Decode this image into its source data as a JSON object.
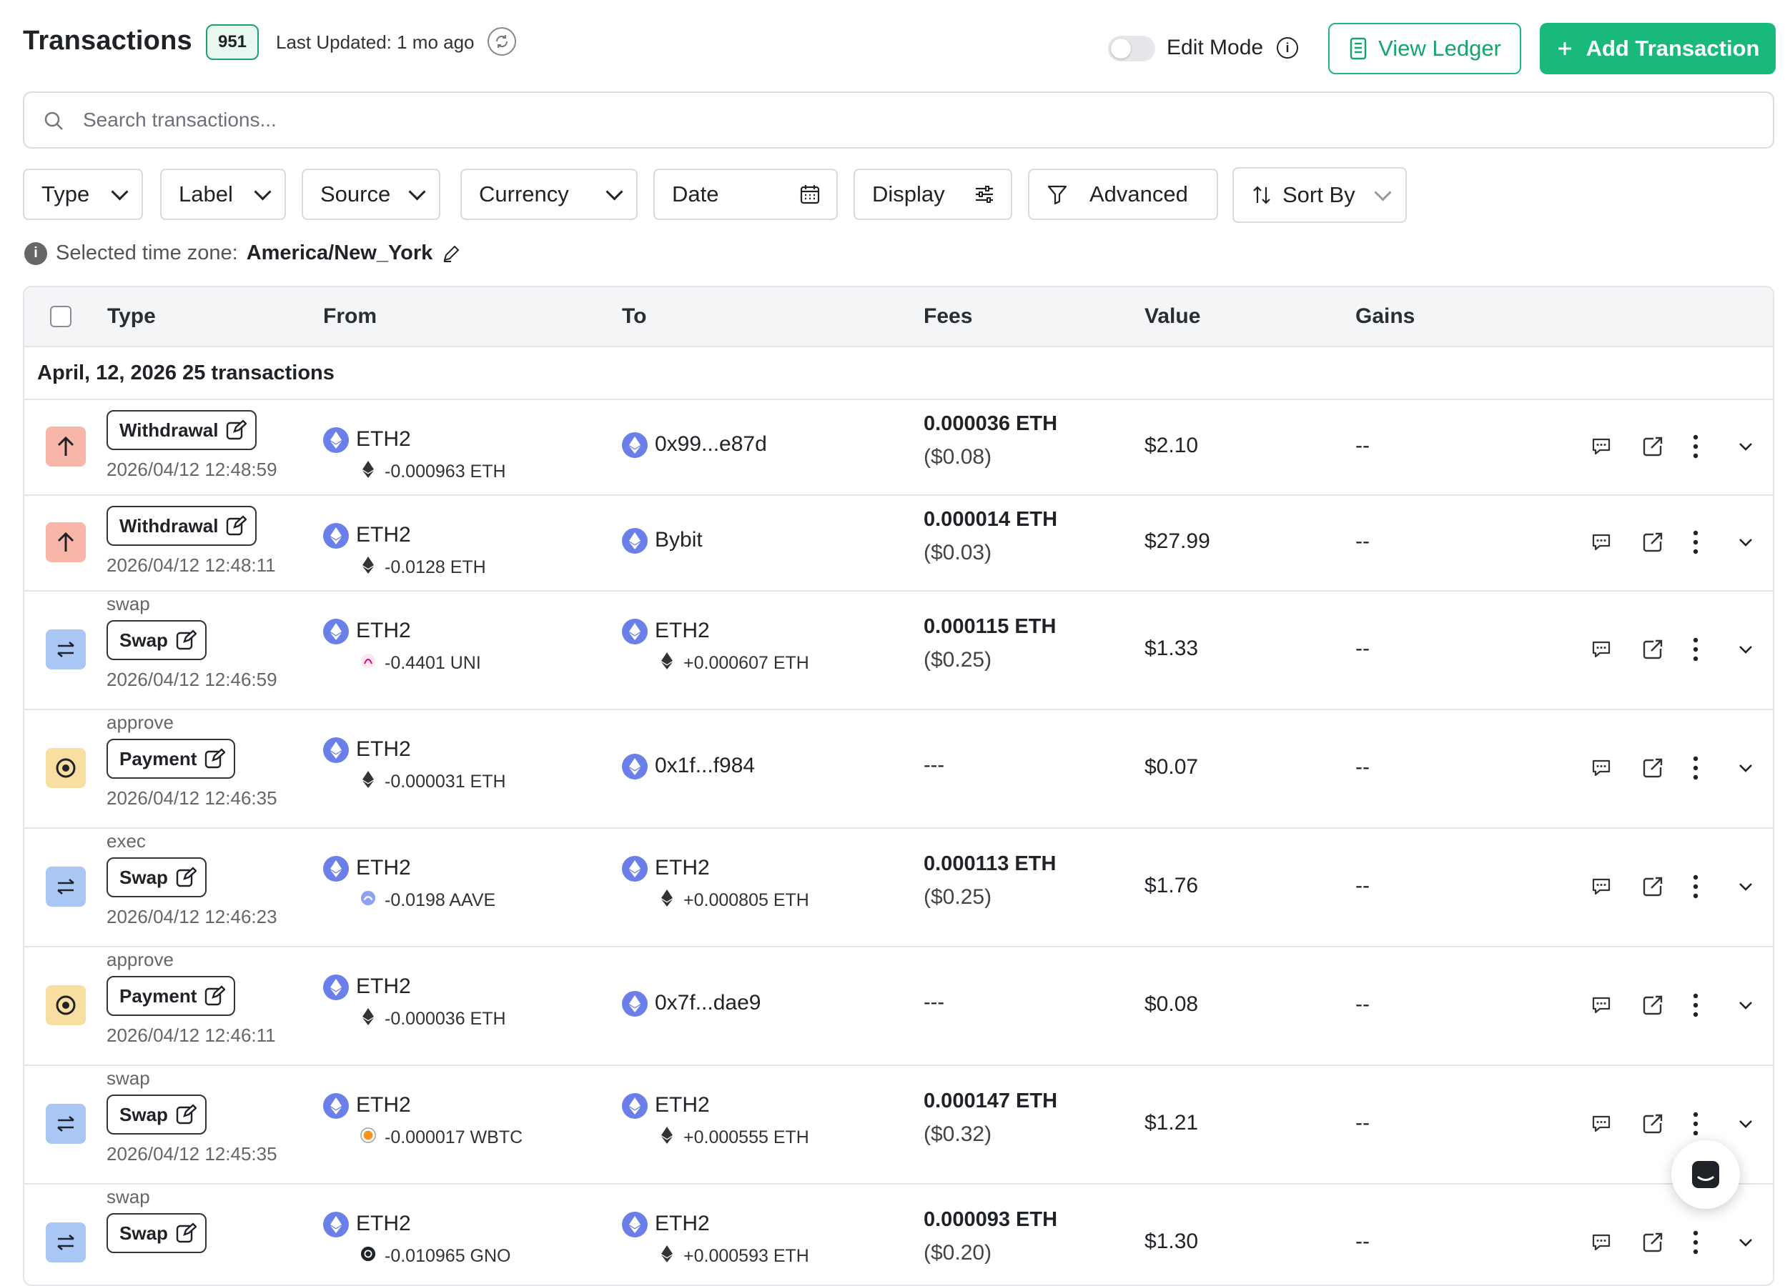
{
  "header": {
    "title": "Transactions",
    "count": "951",
    "last_updated": "Last Updated: 1 mo ago",
    "edit_mode_label": "Edit Mode",
    "edit_mode_on": false,
    "view_ledger": "View Ledger",
    "add_transaction": "Add Transaction"
  },
  "search": {
    "placeholder": "Search transactions..."
  },
  "filters": [
    "Type",
    "Label",
    "Source",
    "Currency",
    "Date",
    "Display",
    "Advanced",
    "Sort By"
  ],
  "timezone": {
    "prefix": "Selected time zone:",
    "value": "America/New_York"
  },
  "table": {
    "columns": [
      "Type",
      "From",
      "To",
      "Fees",
      "Value",
      "Gains"
    ],
    "group": "April, 12, 2026 25 transactions",
    "rows": [
      {
        "kind": "withdrawal",
        "subtitle": "",
        "label": "Withdrawal",
        "time": "2026/04/12 12:48:59",
        "from": "ETH2",
        "from_amount": "-0.000963 ETH",
        "from_asset": "ETH",
        "to": "0x99...e87d",
        "to_amount": "",
        "fee": "0.000036 ETH",
        "fee_usd": "($0.08)",
        "value": "$2.10",
        "gains": "--"
      },
      {
        "kind": "withdrawal",
        "subtitle": "",
        "label": "Withdrawal",
        "time": "2026/04/12 12:48:11",
        "from": "ETH2",
        "from_amount": "-0.0128 ETH",
        "from_asset": "ETH",
        "to": "Bybit",
        "to_amount": "",
        "fee": "0.000014 ETH",
        "fee_usd": "($0.03)",
        "value": "$27.99",
        "gains": "--"
      },
      {
        "kind": "swap",
        "subtitle": "swap",
        "label": "Swap",
        "time": "2026/04/12 12:46:59",
        "from": "ETH2",
        "from_amount": "-0.4401 UNI",
        "from_asset": "UNI",
        "to": "ETH2",
        "to_amount": "+0.000607 ETH",
        "fee": "0.000115 ETH",
        "fee_usd": "($0.25)",
        "value": "$1.33",
        "gains": "--"
      },
      {
        "kind": "payment",
        "subtitle": "approve",
        "label": "Payment",
        "time": "2026/04/12 12:46:35",
        "from": "ETH2",
        "from_amount": "-0.000031 ETH",
        "from_asset": "ETH",
        "to": "0x1f...f984",
        "to_amount": "",
        "fee": "---",
        "fee_usd": "",
        "value": "$0.07",
        "gains": "--"
      },
      {
        "kind": "swap",
        "subtitle": "exec",
        "label": "Swap",
        "time": "2026/04/12 12:46:23",
        "from": "ETH2",
        "from_amount": "-0.0198 AAVE",
        "from_asset": "AAVE",
        "to": "ETH2",
        "to_amount": "+0.000805 ETH",
        "fee": "0.000113 ETH",
        "fee_usd": "($0.25)",
        "value": "$1.76",
        "gains": "--"
      },
      {
        "kind": "payment",
        "subtitle": "approve",
        "label": "Payment",
        "time": "2026/04/12 12:46:11",
        "from": "ETH2",
        "from_amount": "-0.000036 ETH",
        "from_asset": "ETH",
        "to": "0x7f...dae9",
        "to_amount": "",
        "fee": "---",
        "fee_usd": "",
        "value": "$0.08",
        "gains": "--"
      },
      {
        "kind": "swap",
        "subtitle": "swap",
        "label": "Swap",
        "time": "2026/04/12 12:45:35",
        "from": "ETH2",
        "from_amount": "-0.000017 WBTC",
        "from_asset": "WBTC",
        "to": "ETH2",
        "to_amount": "+0.000555 ETH",
        "fee": "0.000147 ETH",
        "fee_usd": "($0.32)",
        "value": "$1.21",
        "gains": "--"
      },
      {
        "kind": "swap",
        "subtitle": "swap",
        "label": "Swap",
        "time": "",
        "from": "ETH2",
        "from_amount": "-0.010965 GNO",
        "from_asset": "GNO",
        "to": "ETH2",
        "to_amount": "+0.000593 ETH",
        "fee": "0.000093 ETH",
        "fee_usd": "($0.20)",
        "value": "$1.30",
        "gains": "--"
      }
    ]
  },
  "colors": {
    "accent": "#19b97b",
    "withdrawal": "#f7b6a8",
    "swap": "#a9c7f5",
    "payment": "#f8dfa1",
    "eth_coin": "#6b7fe8"
  },
  "icons": [
    "refresh-icon",
    "info-icon",
    "ledger-icon",
    "plus-icon",
    "search-icon",
    "chevron-down-icon",
    "calendar-icon",
    "sliders-icon",
    "filter-icon",
    "sort-icon",
    "edit-icon",
    "comment-icon",
    "external-link-icon",
    "more-vertical-icon",
    "chat-icon"
  ]
}
